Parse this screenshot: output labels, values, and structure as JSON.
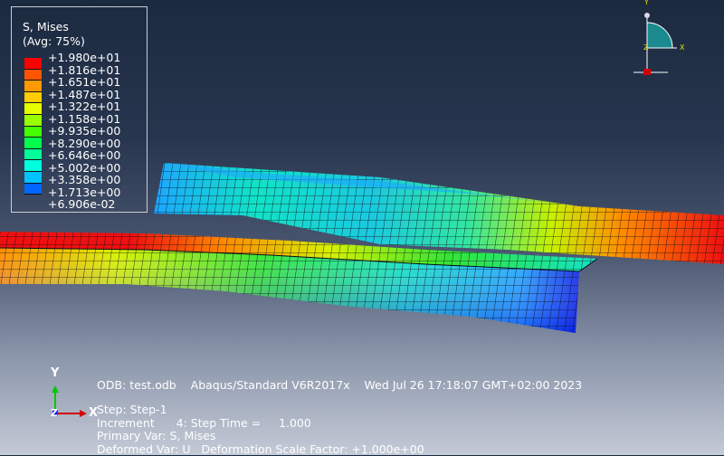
{
  "legend": {
    "title": "S, Mises",
    "subtitle": "(Avg: 75%)",
    "values": [
      "+1.980e+01",
      "+1.816e+01",
      "+1.651e+01",
      "+1.487e+01",
      "+1.322e+01",
      "+1.158e+01",
      "+9.935e+00",
      "+8.290e+00",
      "+6.646e+00",
      "+5.002e+00",
      "+3.358e+00",
      "+1.713e+00",
      "+6.906e-02"
    ],
    "colors": [
      "#ff0000",
      "#ff5500",
      "#ff9900",
      "#ffcc00",
      "#e6ff00",
      "#99ff00",
      "#44ff00",
      "#00ff4d",
      "#00ff99",
      "#00ffdd",
      "#00c2ff",
      "#0066ff",
      "#0000ff"
    ]
  },
  "info": {
    "odb": "ODB: test.odb",
    "solver": "Abaqus/Standard V6R2017x",
    "date": "Wed Jul 26 17:18:07 GMT+02:00 2023",
    "step": "Step: Step-1",
    "increment": "Increment      4: Step Time =     1.000",
    "primary_var": "Primary Var: S, Mises",
    "deformed_var": "Deformed Var: U   Deformation Scale Factor: +1.000e+00"
  },
  "triad": {
    "y": "Y",
    "x": "X",
    "z": "Z"
  },
  "mini_triad": {
    "y": "Y",
    "x": "X",
    "z": "Z"
  },
  "mesh_colors": {
    "red": "#ee1010",
    "orange": "#ff8c00",
    "yellow": "#d8f000",
    "green": "#33e633",
    "cyan": "#12e3c6",
    "lightblue": "#1da6ff",
    "blue": "#0a1fe6",
    "grid": "#0b0b18"
  }
}
